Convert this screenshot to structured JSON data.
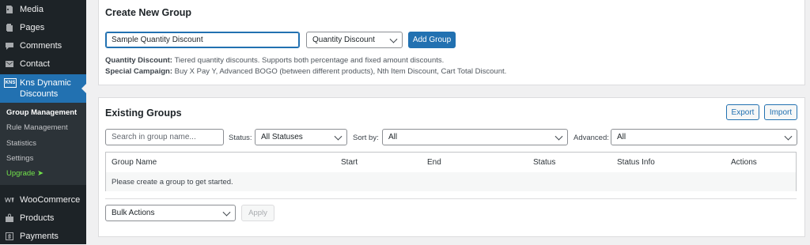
{
  "sidebar": {
    "items_top": [
      {
        "label": "Media",
        "icon": "media-icon"
      },
      {
        "label": "Pages",
        "icon": "pages-icon"
      },
      {
        "label": "Comments",
        "icon": "comments-icon"
      },
      {
        "label": "Contact",
        "icon": "contact-icon"
      }
    ],
    "current": {
      "label": "Kns Dynamic Discounts",
      "icon_text": "KNS"
    },
    "submenu": [
      "Group Management",
      "Rule Management",
      "Statistics",
      "Settings",
      "Upgrade ➤"
    ],
    "items_bottom": [
      {
        "label": "WooCommerce",
        "icon": "woocommerce-icon"
      },
      {
        "label": "Products",
        "icon": "products-icon"
      },
      {
        "label": "Payments",
        "icon": "payments-icon"
      }
    ],
    "colors": {
      "bg": "#1d2327",
      "active": "#2271b1",
      "upgrade": "#72e24b"
    }
  },
  "create": {
    "title": "Create New Group",
    "name_value": "Sample Quantity Discount",
    "type_selected": "Quantity Discount",
    "add_button": "Add Group",
    "desc1_label": "Quantity Discount:",
    "desc1_text": " Tiered quantity discounts. Supports both percentage and fixed amount discounts.",
    "desc2_label": "Special Campaign:",
    "desc2_text": " Buy X Pay Y, Advanced BOGO (between different products), Nth Item Discount, Cart Total Discount."
  },
  "existing": {
    "title": "Existing Groups",
    "export_button": "Export",
    "import_button": "Import",
    "search_placeholder": "Search in group name...",
    "status_label": "Status:",
    "status_selected": "All Statuses",
    "sortby_label": "Sort by:",
    "sortby_selected": "All",
    "advanced_label": "Advanced:",
    "advanced_selected": "All",
    "columns": [
      "Group Name",
      "Start",
      "End",
      "Status",
      "Status Info",
      "Actions"
    ],
    "empty_message": "Please create a group to get started.",
    "bulk_selected": "Bulk Actions",
    "apply_button": "Apply"
  }
}
